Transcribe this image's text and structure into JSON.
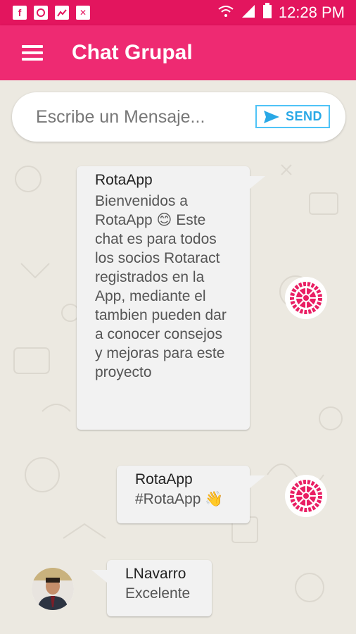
{
  "status_bar": {
    "time": "12:28 PM"
  },
  "app_bar": {
    "title": "Chat Grupal"
  },
  "composer": {
    "placeholder": "Escribe un Mensaje...",
    "send_label": "SEND"
  },
  "messages": [
    {
      "sender": "RotaApp",
      "text": "Bienvenidos a RotaApp 😊 Este chat es para todos los socios Rotaract registrados en la App, mediante el tambien pueden dar a conocer consejos y mejoras para este proyecto"
    },
    {
      "sender": "RotaApp",
      "text": "#RotaApp 👋"
    },
    {
      "sender": "LNavarro",
      "text": "Excelente"
    }
  ],
  "colors": {
    "status_bar": "#e3155e",
    "app_bar": "#ee2a72",
    "send_accent": "#29a8e6",
    "rotary_pink": "#e91e63"
  },
  "icons": [
    "facebook-icon",
    "browser-icon",
    "image-icon",
    "sim-icon",
    "wifi-icon",
    "signal-icon",
    "battery-icon",
    "menu-icon",
    "send-icon",
    "rotary-wheel-icon",
    "user-avatar"
  ]
}
